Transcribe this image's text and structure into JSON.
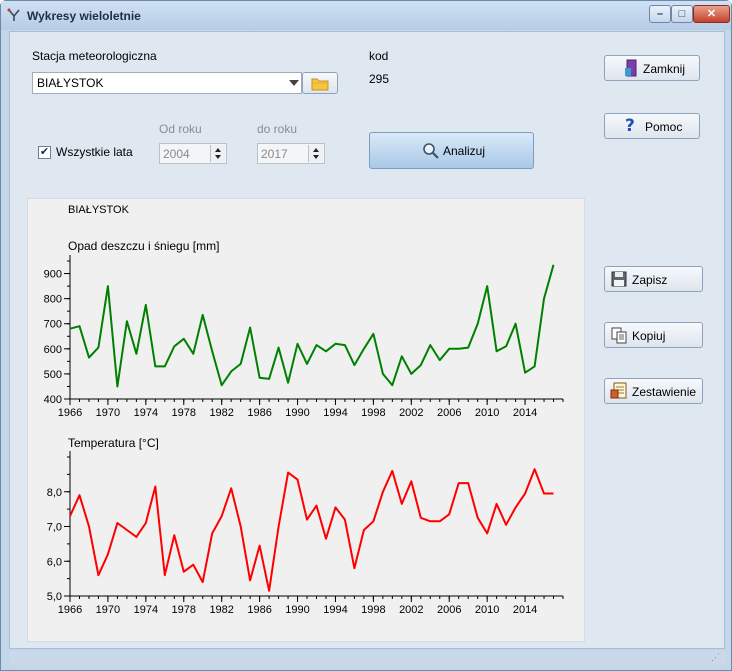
{
  "window": {
    "title": "Wykresy wieloletnie"
  },
  "station": {
    "label": "Stacja meteorologiczna",
    "value": "BIAŁYSTOK"
  },
  "code": {
    "label": "kod",
    "value": "295"
  },
  "years": {
    "all_label": "Wszystkie lata",
    "all_checked": true,
    "from_label": "Od roku",
    "from_value": "2004",
    "to_label": "do roku",
    "to_value": "2017"
  },
  "buttons": {
    "analyze": "Analizuj",
    "close": "Zamknij",
    "help": "Pomoc",
    "save": "Zapisz",
    "copy": "Kopiuj",
    "summary": "Zestawienie"
  },
  "chart_data": [
    {
      "type": "line",
      "subtitle": "BIAŁYSTOK",
      "title": "Opad deszczu i śniegu [mm]",
      "color": "#008000",
      "x": [
        1966,
        1967,
        1968,
        1969,
        1970,
        1971,
        1972,
        1973,
        1974,
        1975,
        1976,
        1977,
        1978,
        1979,
        1980,
        1981,
        1982,
        1983,
        1984,
        1985,
        1986,
        1987,
        1988,
        1989,
        1990,
        1991,
        1992,
        1993,
        1994,
        1995,
        1996,
        1997,
        1998,
        1999,
        2000,
        2001,
        2002,
        2003,
        2004,
        2005,
        2006,
        2007,
        2008,
        2009,
        2010,
        2011,
        2012,
        2013,
        2014,
        2015,
        2016,
        2017
      ],
      "y": [
        680,
        690,
        565,
        605,
        850,
        450,
        710,
        580,
        775,
        530,
        530,
        610,
        640,
        580,
        735,
        590,
        455,
        510,
        540,
        685,
        485,
        480,
        605,
        465,
        620,
        540,
        615,
        590,
        620,
        615,
        535,
        600,
        660,
        500,
        455,
        570,
        500,
        535,
        615,
        555,
        600,
        600,
        605,
        700,
        850,
        590,
        610,
        700,
        505,
        530,
        800,
        935
      ],
      "xticks": [
        "1966",
        "1970",
        "1974",
        "1978",
        "1982",
        "1986",
        "1990",
        "1994",
        "1998",
        "2002",
        "2006",
        "2010",
        "2014"
      ],
      "yticks": [
        "400",
        "500",
        "600",
        "700",
        "800",
        "900"
      ],
      "ylim": [
        400,
        950
      ],
      "xlim": [
        1966,
        2018
      ]
    },
    {
      "type": "line",
      "title": "Temperatura [°C]",
      "color": "#ff0000",
      "x": [
        1966,
        1967,
        1968,
        1969,
        1970,
        1971,
        1972,
        1973,
        1974,
        1975,
        1976,
        1977,
        1978,
        1979,
        1980,
        1981,
        1982,
        1983,
        1984,
        1985,
        1986,
        1987,
        1988,
        1989,
        1990,
        1991,
        1992,
        1993,
        1994,
        1995,
        1996,
        1997,
        1998,
        1999,
        2000,
        2001,
        2002,
        2003,
        2004,
        2005,
        2006,
        2007,
        2008,
        2009,
        2010,
        2011,
        2012,
        2013,
        2014,
        2015,
        2016,
        2017
      ],
      "y": [
        7.3,
        7.9,
        7.0,
        5.6,
        6.2,
        7.1,
        6.9,
        6.7,
        7.1,
        8.15,
        5.6,
        6.75,
        5.7,
        5.9,
        5.4,
        6.8,
        7.3,
        8.1,
        7.0,
        5.45,
        6.45,
        5.15,
        7.0,
        8.55,
        8.35,
        7.2,
        7.6,
        6.65,
        7.55,
        7.2,
        5.8,
        6.9,
        7.15,
        8.0,
        8.6,
        7.65,
        8.3,
        7.25,
        7.15,
        7.15,
        7.35,
        8.25,
        8.25,
        7.25,
        6.8,
        7.65,
        7.05,
        7.55,
        7.95,
        8.65,
        7.95,
        7.95
      ],
      "xticks": [
        "1966",
        "1970",
        "1974",
        "1978",
        "1982",
        "1986",
        "1990",
        "1994",
        "1998",
        "2002",
        "2006",
        "2010",
        "2014"
      ],
      "yticks": [
        "5,0",
        "6,0",
        "7,0",
        "8,0"
      ],
      "ylim": [
        5.0,
        9.0
      ],
      "xlim": [
        1966,
        2018
      ]
    }
  ]
}
